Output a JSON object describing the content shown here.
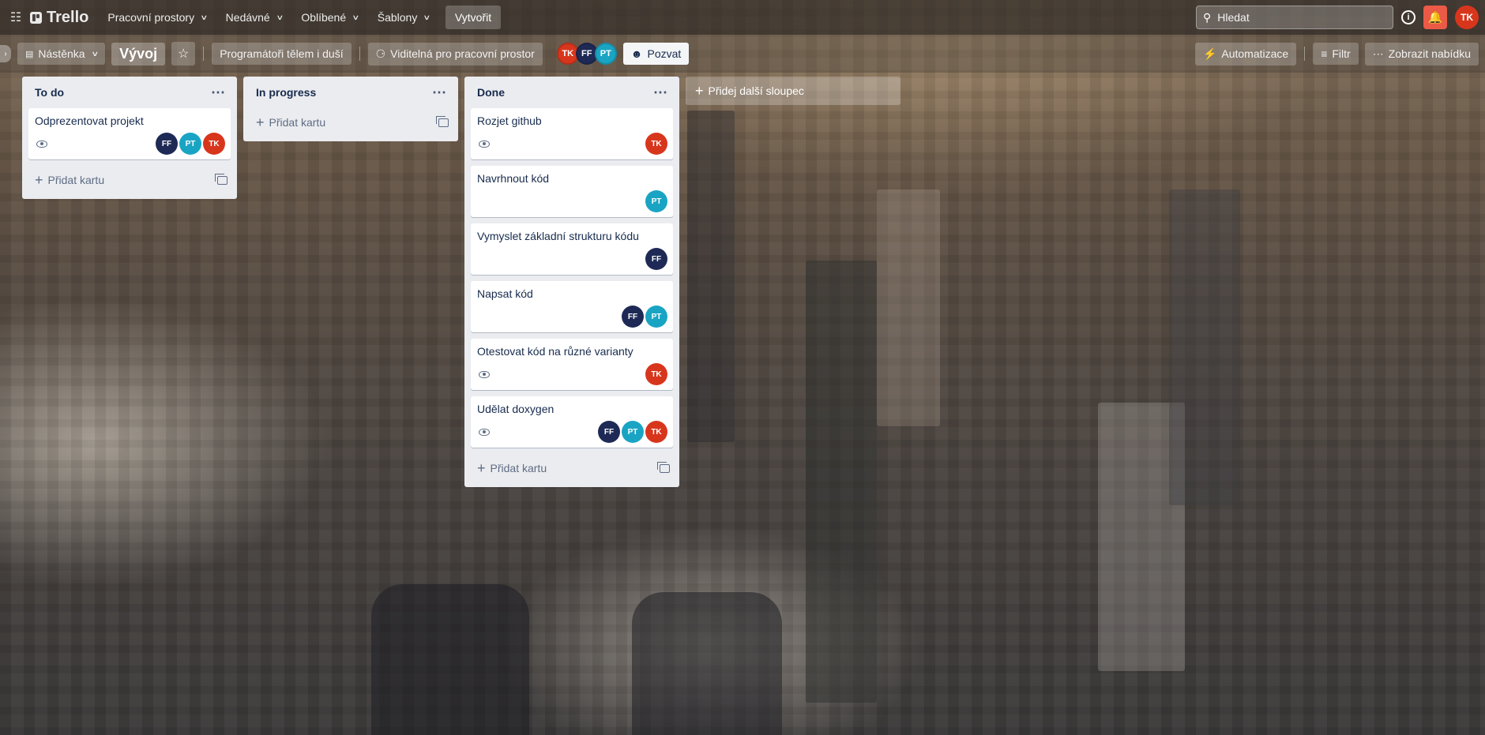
{
  "topnav": {
    "logo": "Trello",
    "menu": [
      {
        "label": "Pracovní prostory"
      },
      {
        "label": "Nedávné"
      },
      {
        "label": "Oblíbené"
      },
      {
        "label": "Šablony"
      }
    ],
    "create_label": "Vytvořit",
    "search_placeholder": "Hledat",
    "user_initials": "TK"
  },
  "board": {
    "view_label": "Nástěnka",
    "title": "Vývoj",
    "workspace_label": "Programátoři tělem i duší",
    "visibility_label": "Viditelná pro pracovní prostor",
    "members": [
      "TK",
      "FF",
      "PT"
    ],
    "invite_label": "Pozvat",
    "automation_label": "Automatizace",
    "filter_label": "Filtr",
    "menu_label": "Zobrazit nabídku",
    "add_list_label": "Přidej další sloupec"
  },
  "lists": [
    {
      "title": "To do",
      "add_card_label": "Přidat kartu",
      "cards": [
        {
          "title": "Odprezentovat projekt",
          "watched": true,
          "members": [
            "FF",
            "PT",
            "TK"
          ]
        }
      ]
    },
    {
      "title": "In progress",
      "add_card_label": "Přidat kartu",
      "cards": []
    },
    {
      "title": "Done",
      "add_card_label": "Přidat kartu",
      "cards": [
        {
          "title": "Rozjet github",
          "watched": true,
          "members": [
            "TK"
          ]
        },
        {
          "title": "Navrhnout kód",
          "watched": false,
          "members": [
            "PT"
          ]
        },
        {
          "title": "Vymyslet základní strukturu kódu",
          "watched": false,
          "members": [
            "FF"
          ]
        },
        {
          "title": "Napsat kód",
          "watched": false,
          "members": [
            "FF",
            "PT"
          ]
        },
        {
          "title": "Otestovat kód na různé varianty",
          "watched": true,
          "members": [
            "TK"
          ]
        },
        {
          "title": "Udělat doxygen",
          "watched": true,
          "members": [
            "FF",
            "PT",
            "TK"
          ]
        }
      ]
    }
  ],
  "colors": {
    "TK": "#d8361c",
    "FF": "#1e2a55",
    "PT": "#1aa4c4",
    "list_bg": "#ebecf0",
    "notification": "#eb5a46"
  }
}
